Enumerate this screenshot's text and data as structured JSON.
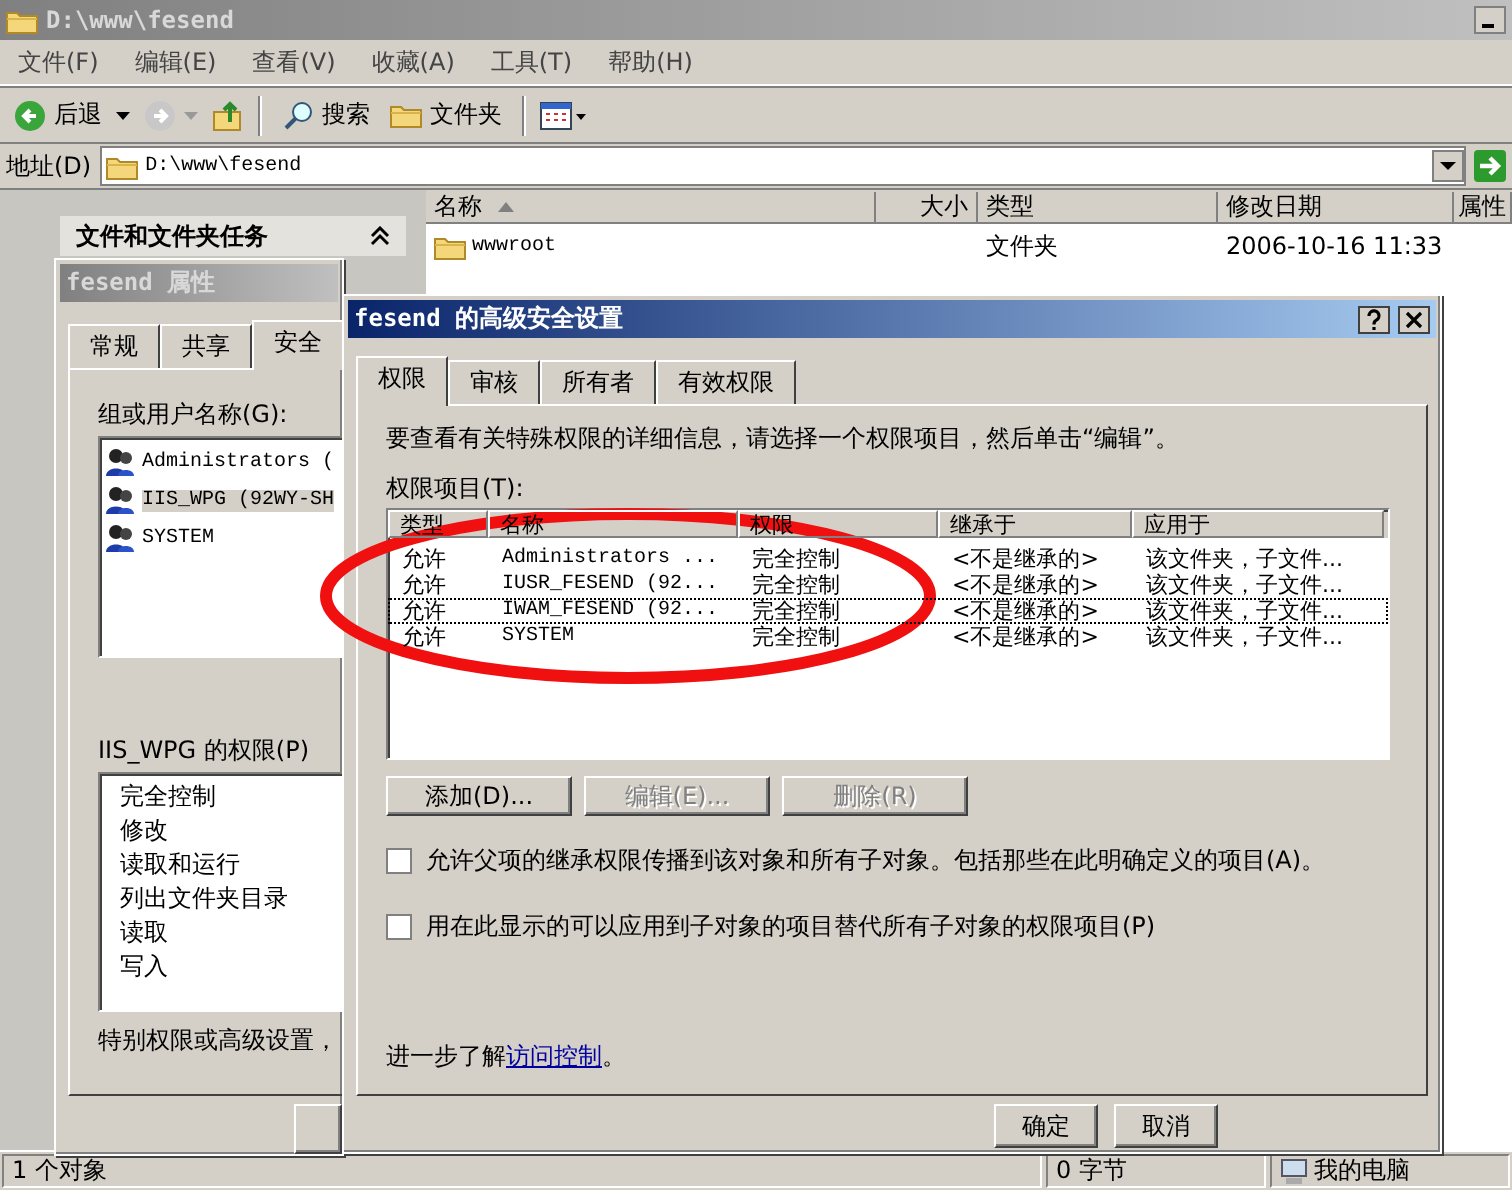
{
  "explorer": {
    "title": "D:\\www\\fesend",
    "menu": [
      "文件(F)",
      "编辑(E)",
      "查看(V)",
      "收藏(A)",
      "工具(T)",
      "帮助(H)"
    ],
    "toolbar": {
      "back": "后退",
      "search": "搜索",
      "folders": "文件夹"
    },
    "address": {
      "label": "地址(D)",
      "value": "D:\\www\\fesend"
    },
    "task_pane": {
      "title": "文件和文件夹任务"
    },
    "file_list": {
      "columns": [
        "名称",
        "大小",
        "类型",
        "修改日期",
        "属性"
      ],
      "rows": [
        {
          "name": "wwwroot",
          "type": "文件夹",
          "modified": "2006-10-16 11:33"
        }
      ]
    },
    "status_bar": [
      "1 个对象",
      "0 字节",
      "我的电脑"
    ]
  },
  "properties_dialog": {
    "title": "fesend 属性",
    "tabs": [
      {
        "label": "常规",
        "selected": false
      },
      {
        "label": "共享",
        "selected": false
      },
      {
        "label": "安全",
        "selected": true
      }
    ],
    "group_label": "组或用户名称(G):",
    "users": [
      {
        "name": "Administrators (",
        "selected": false
      },
      {
        "name": "IIS_WPG (92WY-SH",
        "selected": true
      },
      {
        "name": "SYSTEM",
        "selected": false
      }
    ],
    "permissions_label": "IIS_WPG 的权限(P)",
    "permissions": [
      "完全控制",
      "修改",
      "读取和运行",
      "列出文件夹目录",
      "读取",
      "写入"
    ],
    "note": "特别权限或高级设置，"
  },
  "advanced_dialog": {
    "title": "fesend 的高级安全设置",
    "tabs": [
      {
        "label": "权限",
        "selected": true
      },
      {
        "label": "审核",
        "selected": false
      },
      {
        "label": "所有者",
        "selected": false
      },
      {
        "label": "有效权限",
        "selected": false
      }
    ],
    "description": "要查看有关特殊权限的详细信息，请选择一个权限项目，然后单击“编辑”。",
    "entries_label": "权限项目(T):",
    "columns": [
      "类型",
      "名称",
      "权限",
      "继承于",
      "应用于"
    ],
    "entries": [
      {
        "type": "允许",
        "name": "Administrators ...",
        "permission": "完全控制",
        "inherited_from": "<不是继承的>",
        "applies_to": "该文件夹，子文件...",
        "focused": false
      },
      {
        "type": "允许",
        "name": "IUSR_FESEND (92...",
        "permission": "完全控制",
        "inherited_from": "<不是继承的>",
        "applies_to": "该文件夹，子文件...",
        "focused": false
      },
      {
        "type": "允许",
        "name": "IWAM_FESEND (92...",
        "permission": "完全控制",
        "inherited_from": "<不是继承的>",
        "applies_to": "该文件夹，子文件...",
        "focused": true
      },
      {
        "type": "允许",
        "name": "SYSTEM",
        "permission": "完全控制",
        "inherited_from": "<不是继承的>",
        "applies_to": "该文件夹，子文件...",
        "focused": false
      }
    ],
    "buttons": [
      {
        "label": "添加(D)...",
        "disabled": false
      },
      {
        "label": "编辑(E)...",
        "disabled": true
      },
      {
        "label": "删除(R)",
        "disabled": true
      }
    ],
    "options": [
      {
        "label": "允许父项的继承权限传播到该对象和所有子对象。包括那些在此明确定义的项目(A)。",
        "checked": false
      },
      {
        "label": "用在此显示的可以应用到子对象的项目替代所有子对象的权限项目(P)",
        "checked": false
      }
    ],
    "learn_more": {
      "text": "进一步了解",
      "link": "访问控制",
      "end": "。"
    },
    "footer_buttons": [
      "确定",
      "取消"
    ]
  }
}
